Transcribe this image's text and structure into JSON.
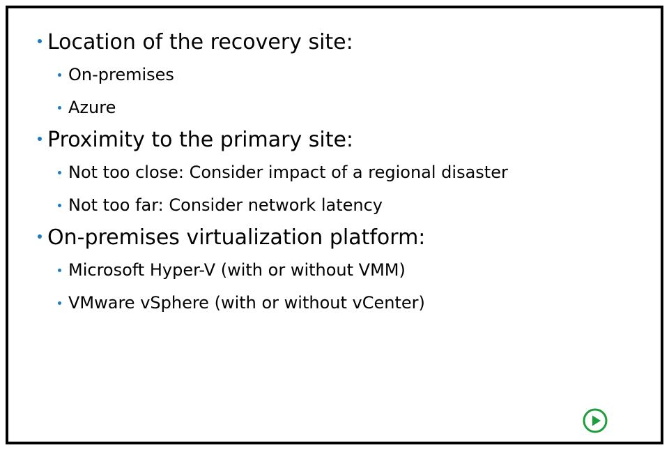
{
  "bullets": [
    {
      "text": "Location of the recovery site:",
      "children": [
        "On-premises",
        "Azure"
      ]
    },
    {
      "text": "Proximity to the primary site:",
      "children": [
        "Not too close: Consider impact of a regional disaster",
        "Not too far: Consider network latency"
      ]
    },
    {
      "text": "On-premises virtualization platform:",
      "children": [
        "Microsoft Hyper-V (with or without VMM)",
        "VMware vSphere (with or without vCenter)"
      ]
    }
  ],
  "controls": {
    "play_icon": "play-circle-icon"
  },
  "colors": {
    "bullet": "#1f7bc1",
    "play": "#1e9e3a",
    "border": "#000000"
  }
}
